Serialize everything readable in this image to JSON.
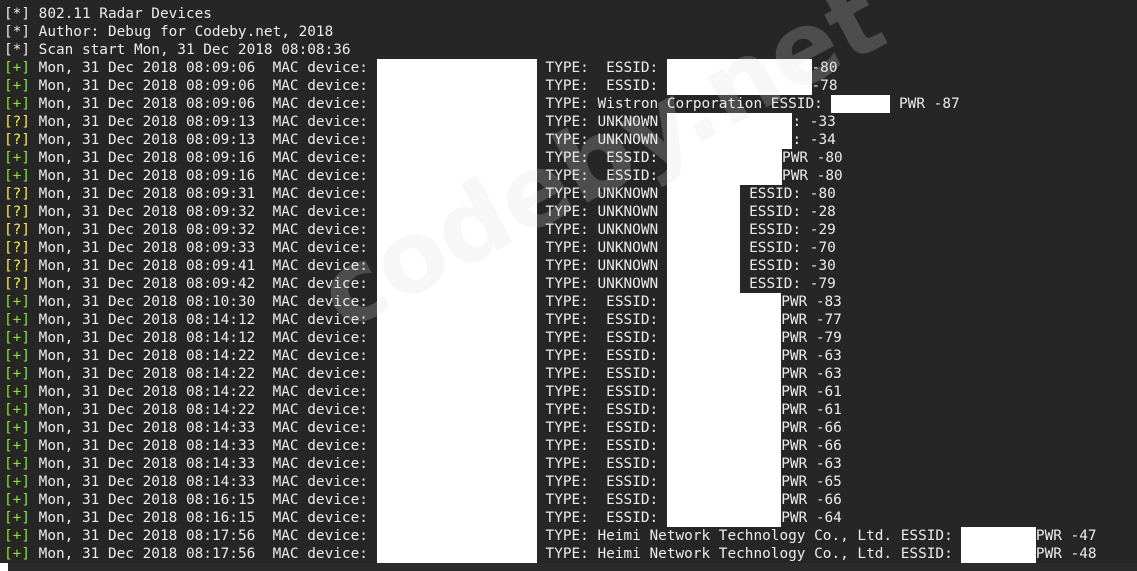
{
  "terminal": {
    "header": [
      "[*] 802.11 Radar Devices",
      "[*] Author: Debug for Codeby.net, 2018",
      "[*] Scan start Mon, 31 Dec 2018 08:08:36"
    ],
    "mac_label": "MAC device: ",
    "colors": {
      "plus": "#8ae234",
      "question": "#fce94f",
      "text": "#ececec",
      "background": "#262626"
    },
    "rows": [
      {
        "tag": "[+]",
        "time": "Mon, 31 Dec 2018 08:09:06",
        "type": "TYPE:  ESSID: ",
        "tail": "-80"
      },
      {
        "tag": "[+]",
        "time": "Mon, 31 Dec 2018 08:09:06",
        "type": "TYPE:  ESSID: ",
        "tail": "-78"
      },
      {
        "tag": "[+]",
        "time": "Mon, 31 Dec 2018 08:09:06",
        "type": "TYPE: Wistron Corporation ESSID: ",
        "tail": " PWR -87"
      },
      {
        "tag": "[?]",
        "time": "Mon, 31 Dec 2018 08:09:13",
        "type": "TYPE: UNKNOWN ",
        "tail": ": -33"
      },
      {
        "tag": "[?]",
        "time": "Mon, 31 Dec 2018 08:09:13",
        "type": "TYPE: UNKNOWN ",
        "tail": ": -34"
      },
      {
        "tag": "[+]",
        "time": "Mon, 31 Dec 2018 08:09:16",
        "type": "TYPE:  ESSID: ",
        "tail": "PWR -80"
      },
      {
        "tag": "[+]",
        "time": "Mon, 31 Dec 2018 08:09:16",
        "type": "TYPE:  ESSID: ",
        "tail": "PWR -80"
      },
      {
        "tag": "[?]",
        "time": "Mon, 31 Dec 2018 08:09:31",
        "type": "TYPE: UNKNOWN ",
        "tail": " ESSID: -80"
      },
      {
        "tag": "[?]",
        "time": "Mon, 31 Dec 2018 08:09:32",
        "type": "TYPE: UNKNOWN ",
        "tail": " ESSID: -28"
      },
      {
        "tag": "[?]",
        "time": "Mon, 31 Dec 2018 08:09:32",
        "type": "TYPE: UNKNOWN ",
        "tail": " ESSID: -29"
      },
      {
        "tag": "[?]",
        "time": "Mon, 31 Dec 2018 08:09:33",
        "type": "TYPE: UNKNOWN ",
        "tail": " ESSID: -70"
      },
      {
        "tag": "[?]",
        "time": "Mon, 31 Dec 2018 08:09:41",
        "type": "TYPE: UNKNOWN ",
        "tail": " ESSID: -30"
      },
      {
        "tag": "[?]",
        "time": "Mon, 31 Dec 2018 08:09:42",
        "type": "TYPE: UNKNOWN ",
        "tail": " ESSID: -79"
      },
      {
        "tag": "[+]",
        "time": "Mon, 31 Dec 2018 08:10:30",
        "type": "TYPE:  ESSID: ",
        "tail": "PWR -83"
      },
      {
        "tag": "[+]",
        "time": "Mon, 31 Dec 2018 08:14:12",
        "type": "TYPE:  ESSID: ",
        "tail": "PWR -77"
      },
      {
        "tag": "[+]",
        "time": "Mon, 31 Dec 2018 08:14:12",
        "type": "TYPE:  ESSID: ",
        "tail": "PWR -79"
      },
      {
        "tag": "[+]",
        "time": "Mon, 31 Dec 2018 08:14:22",
        "type": "TYPE:  ESSID: ",
        "tail": "PWR -63"
      },
      {
        "tag": "[+]",
        "time": "Mon, 31 Dec 2018 08:14:22",
        "type": "TYPE:  ESSID: ",
        "tail": "PWR -63"
      },
      {
        "tag": "[+]",
        "time": "Mon, 31 Dec 2018 08:14:22",
        "type": "TYPE:  ESSID: ",
        "tail": "PWR -61"
      },
      {
        "tag": "[+]",
        "time": "Mon, 31 Dec 2018 08:14:22",
        "type": "TYPE:  ESSID: ",
        "tail": "PWR -61"
      },
      {
        "tag": "[+]",
        "time": "Mon, 31 Dec 2018 08:14:33",
        "type": "TYPE:  ESSID: ",
        "tail": "PWR -66"
      },
      {
        "tag": "[+]",
        "time": "Mon, 31 Dec 2018 08:14:33",
        "type": "TYPE:  ESSID: ",
        "tail": "PWR -66"
      },
      {
        "tag": "[+]",
        "time": "Mon, 31 Dec 2018 08:14:33",
        "type": "TYPE:  ESSID: ",
        "tail": "PWR -63"
      },
      {
        "tag": "[+]",
        "time": "Mon, 31 Dec 2018 08:14:33",
        "type": "TYPE:  ESSID: ",
        "tail": "PWR -65"
      },
      {
        "tag": "[+]",
        "time": "Mon, 31 Dec 2018 08:16:15",
        "type": "TYPE:  ESSID: ",
        "tail": "PWR -66"
      },
      {
        "tag": "[+]",
        "time": "Mon, 31 Dec 2018 08:16:15",
        "type": "TYPE:  ESSID: ",
        "tail": "PWR -64"
      },
      {
        "tag": "[+]",
        "time": "Mon, 31 Dec 2018 08:17:56",
        "type": "TYPE: Heimi Network Technology Co., Ltd. ESSID: ",
        "tail": "PWR -47"
      },
      {
        "tag": "[+]",
        "time": "Mon, 31 Dec 2018 08:17:56",
        "type": "TYPE: Heimi Network Technology Co., Ltd. ESSID: ",
        "tail": "PWR -48"
      }
    ]
  },
  "watermark": "codeby.net"
}
